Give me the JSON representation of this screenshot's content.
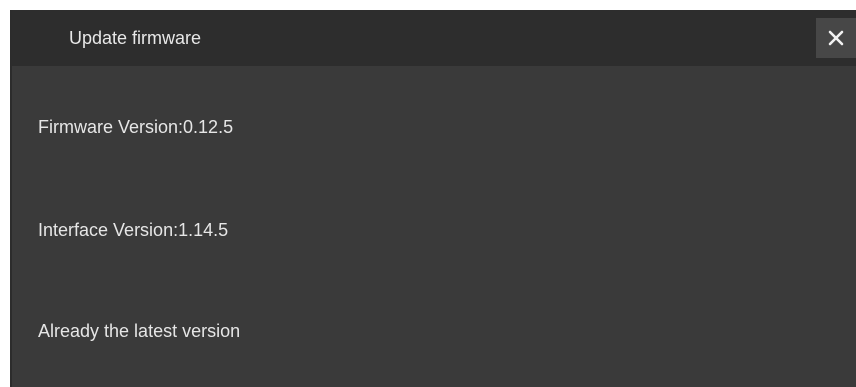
{
  "dialog": {
    "title": "Update firmware",
    "close_icon": "close-icon"
  },
  "info": {
    "firmware_version": "Firmware Version:0.12.5",
    "interface_version": "Interface Version:1.14.5",
    "status": "Already the latest version"
  },
  "colors": {
    "dialog_background": "#3a3a3a",
    "titlebar_background": "#2d2d2d",
    "close_button_background": "#474747",
    "text": "#e6e6e6"
  }
}
